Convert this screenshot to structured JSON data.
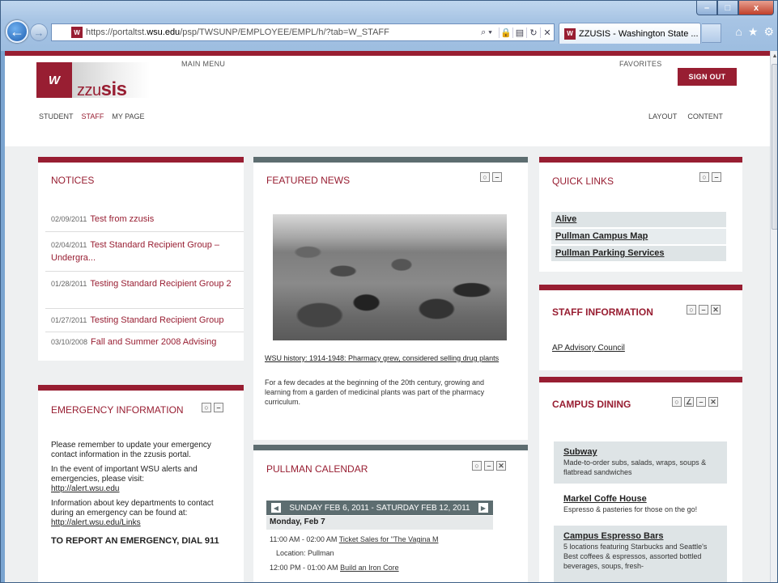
{
  "browser": {
    "url_prefix": "https://portaltst.",
    "url_domain": "wsu.edu",
    "url_path": "/psp/TWSUNP/EMPLOYEE/EMPL/h/?tab=W_STAFF",
    "tab_title": "ZZUSIS - Washington State ...",
    "win_min": "–",
    "win_max": "□",
    "win_close": "x",
    "addr_icons": [
      "⌕ ▾",
      "🔒",
      "▤",
      "↻",
      "✕"
    ]
  },
  "header": {
    "brand_prefix": "ZZU",
    "brand_suffix": "SIS",
    "main_menu": "MAIN MENU",
    "favorites": "FAVORITES",
    "sign_out": "SIGN OUT",
    "nav": [
      "STUDENT",
      "STAFF",
      "MY PAGE"
    ],
    "right_nav": [
      "LAYOUT",
      "CONTENT"
    ]
  },
  "notices": {
    "title": "NOTICES",
    "items": [
      {
        "date": "02/09/2011",
        "text": "Test from zzusis"
      },
      {
        "date": "02/04/2011",
        "text": "Test Standard Recipient Group – Undergra..."
      },
      {
        "date": "01/28/2011",
        "text": "Testing Standard Recipient Group 2"
      },
      {
        "date": "01/27/2011",
        "text": "Testing Standard Recipient Group"
      },
      {
        "date": "03/10/2008",
        "text": "Fall and Summer 2008 Advising"
      }
    ]
  },
  "emergency": {
    "title": "EMERGENCY INFORMATION",
    "p1": "Please remember to update your emergency contact information in the zzusis portal.",
    "p2": "In the event of important WSU alerts and emergencies, please visit:",
    "link1": "http://alert.wsu.edu",
    "p3": "Information about key departments to contact during an emergency can be found at:",
    "link2": "http://alert.wsu.edu/Links",
    "dial": "TO REPORT AN EMERGENCY, DIAL 911"
  },
  "featured": {
    "title": "FEATURED NEWS",
    "headline": "WSU history: 1914-1948: Pharmacy grew, considered selling drug plants",
    "body": "For a few decades at the beginning of the 20th century, growing and learning from a garden of medicinal plants was part of the pharmacy curriculum."
  },
  "calendar": {
    "title": "PULLMAN CALENDAR",
    "range": "SUNDAY FEB 6, 2011 - SATURDAY FEB 12, 2011",
    "day": "Monday, Feb 7",
    "events": [
      {
        "time": "11:00 AM - 02:00 AM",
        "title": "Ticket Sales for \"The Vagina M",
        "location": "Location: Pullman"
      },
      {
        "time": "12:00 PM - 01:00 AM",
        "title": "Build an Iron Core"
      }
    ]
  },
  "quick_links": {
    "title": "QUICK LINKS",
    "items": [
      "Alive",
      "Pullman Campus Map",
      "Pullman Parking Services"
    ]
  },
  "staff_info": {
    "title": "STAFF INFORMATION",
    "link": "AP Advisory Council"
  },
  "dining": {
    "title": "CAMPUS DINING",
    "items": [
      {
        "name": "Subway",
        "desc": "Made-to-order subs, salads, wraps, soups & flatbread sandwiches"
      },
      {
        "name": "Markel Coffe House",
        "desc": "Espresso & pasteries for those on the go!"
      },
      {
        "name": "Campus Espresso Bars",
        "desc": "5 locations featuring Starbucks and Seattle's Best coffees & espressos, assorted bottled beverages, soups, fresh-"
      }
    ]
  }
}
